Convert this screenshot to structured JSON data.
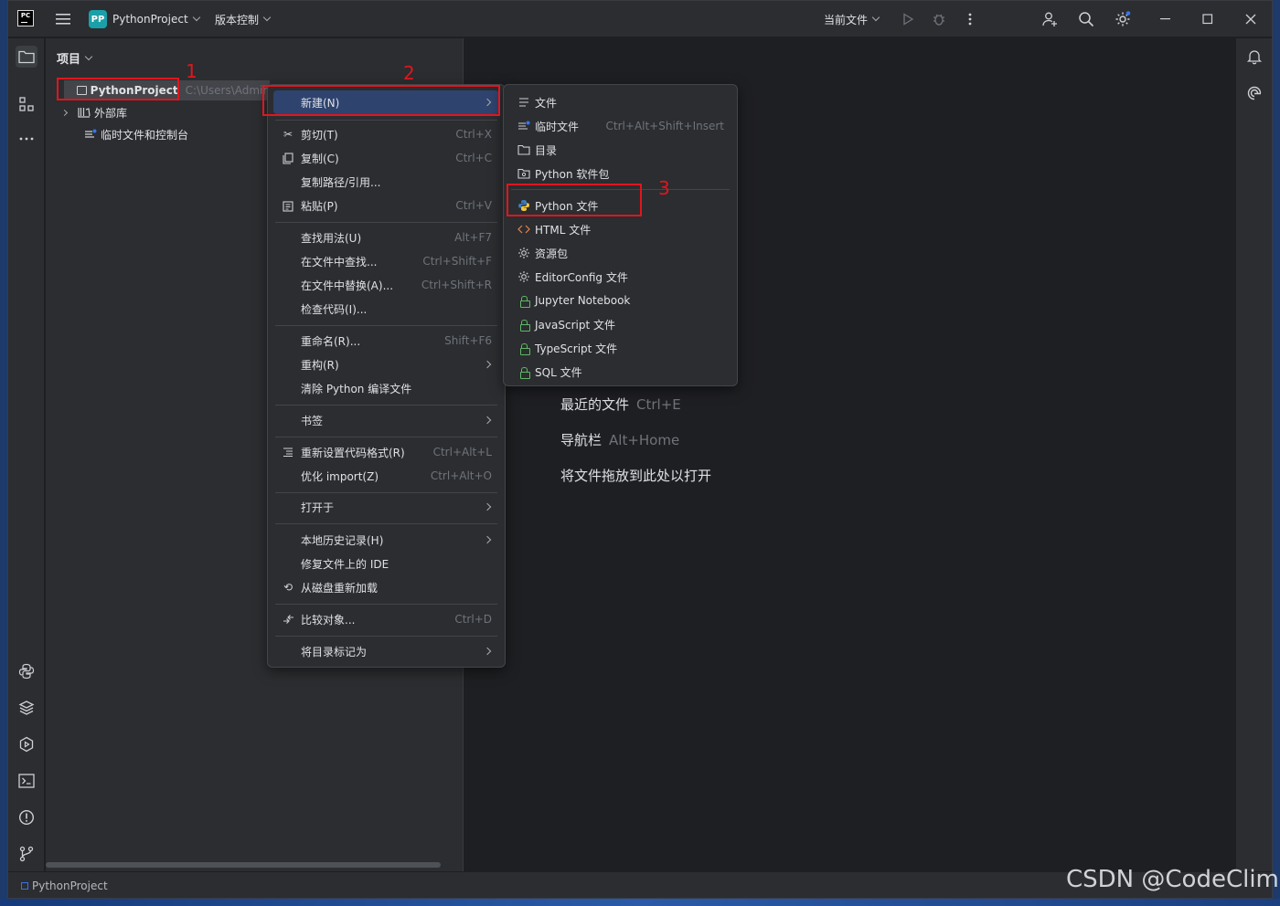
{
  "title_bar": {
    "logo_text": "PC",
    "project_badge": "PP",
    "project_name": "PythonProject",
    "vcs": "版本控制",
    "run_config": "当前文件"
  },
  "project_panel": {
    "header": "项目",
    "tree": [
      {
        "label": "PythonProject",
        "path": "C:\\Users\\Admin"
      },
      {
        "label": "外部库"
      },
      {
        "label": "临时文件和控制台"
      }
    ]
  },
  "editor_hints": [
    {
      "text": "最近的文件",
      "shortcut": "Ctrl+E"
    },
    {
      "text": "导航栏",
      "shortcut": "Alt+Home"
    },
    {
      "text": "将文件拖放到此处以打开",
      "shortcut": ""
    }
  ],
  "context_menu": {
    "items": [
      {
        "label": "新建(N)",
        "shortcut": "",
        "submenu": true,
        "icon": ""
      },
      {
        "label": "剪切(T)",
        "shortcut": "Ctrl+X",
        "icon": "scissors-icon"
      },
      {
        "label": "复制(C)",
        "shortcut": "Ctrl+C",
        "icon": "copy-icon"
      },
      {
        "label": "复制路径/引用...",
        "shortcut": ""
      },
      {
        "label": "粘贴(P)",
        "shortcut": "Ctrl+V",
        "icon": "paste-icon"
      },
      {
        "label": "查找用法(U)",
        "shortcut": "Alt+F7"
      },
      {
        "label": "在文件中查找...",
        "shortcut": "Ctrl+Shift+F"
      },
      {
        "label": "在文件中替换(A)...",
        "shortcut": "Ctrl+Shift+R"
      },
      {
        "label": "检查代码(I)...",
        "shortcut": ""
      },
      {
        "label": "重命名(R)...",
        "shortcut": "Shift+F6"
      },
      {
        "label": "重构(R)",
        "shortcut": "",
        "submenu": true
      },
      {
        "label": "清除 Python 编译文件",
        "shortcut": ""
      },
      {
        "label": "书签",
        "shortcut": "",
        "submenu": true
      },
      {
        "label": "重新设置代码格式(R)",
        "shortcut": "Ctrl+Alt+L",
        "icon": "format-icon"
      },
      {
        "label": "优化 import(Z)",
        "shortcut": "Ctrl+Alt+O"
      },
      {
        "label": "打开于",
        "shortcut": "",
        "submenu": true
      },
      {
        "label": "本地历史记录(H)",
        "shortcut": "",
        "submenu": true
      },
      {
        "label": "修复文件上的 IDE",
        "shortcut": ""
      },
      {
        "label": "从磁盘重新加载",
        "shortcut": "",
        "icon": "reload-icon"
      },
      {
        "label": "比较对象...",
        "shortcut": "Ctrl+D",
        "icon": "compare-icon"
      },
      {
        "label": "将目录标记为",
        "shortcut": "",
        "submenu": true
      }
    ]
  },
  "new_submenu": {
    "items": [
      {
        "label": "文件",
        "shortcut": "",
        "icon": "file-lines-icon"
      },
      {
        "label": "临时文件",
        "shortcut": "Ctrl+Alt+Shift+Insert",
        "icon": "scratch-file-icon"
      },
      {
        "label": "目录",
        "shortcut": "",
        "icon": "folder-icon"
      },
      {
        "label": "Python 软件包",
        "shortcut": "",
        "icon": "package-icon"
      },
      {
        "label": "Python 文件",
        "shortcut": "",
        "icon": "python-icon"
      },
      {
        "label": "HTML 文件",
        "shortcut": "",
        "icon": "html-icon"
      },
      {
        "label": "资源包",
        "shortcut": "",
        "icon": "resource-bundle-icon"
      },
      {
        "label": "EditorConfig 文件",
        "shortcut": "",
        "icon": "gear-icon"
      },
      {
        "label": "Jupyter Notebook",
        "shortcut": "",
        "icon": "lock-icon"
      },
      {
        "label": "JavaScript 文件",
        "shortcut": "",
        "icon": "lock-icon"
      },
      {
        "label": "TypeScript 文件",
        "shortcut": "",
        "icon": "lock-icon"
      },
      {
        "label": "SQL 文件",
        "shortcut": "",
        "icon": "lock-icon"
      }
    ]
  },
  "annotations": [
    "1",
    "2",
    "3"
  ],
  "status_bar": {
    "project": "PythonProject"
  },
  "watermark": "CSDN @CodeClimb",
  "colors": {
    "accent": "#3574f0",
    "highlight": "#2e436e",
    "annotation_red": "#e0161e",
    "lock_green": "#5fb865"
  }
}
